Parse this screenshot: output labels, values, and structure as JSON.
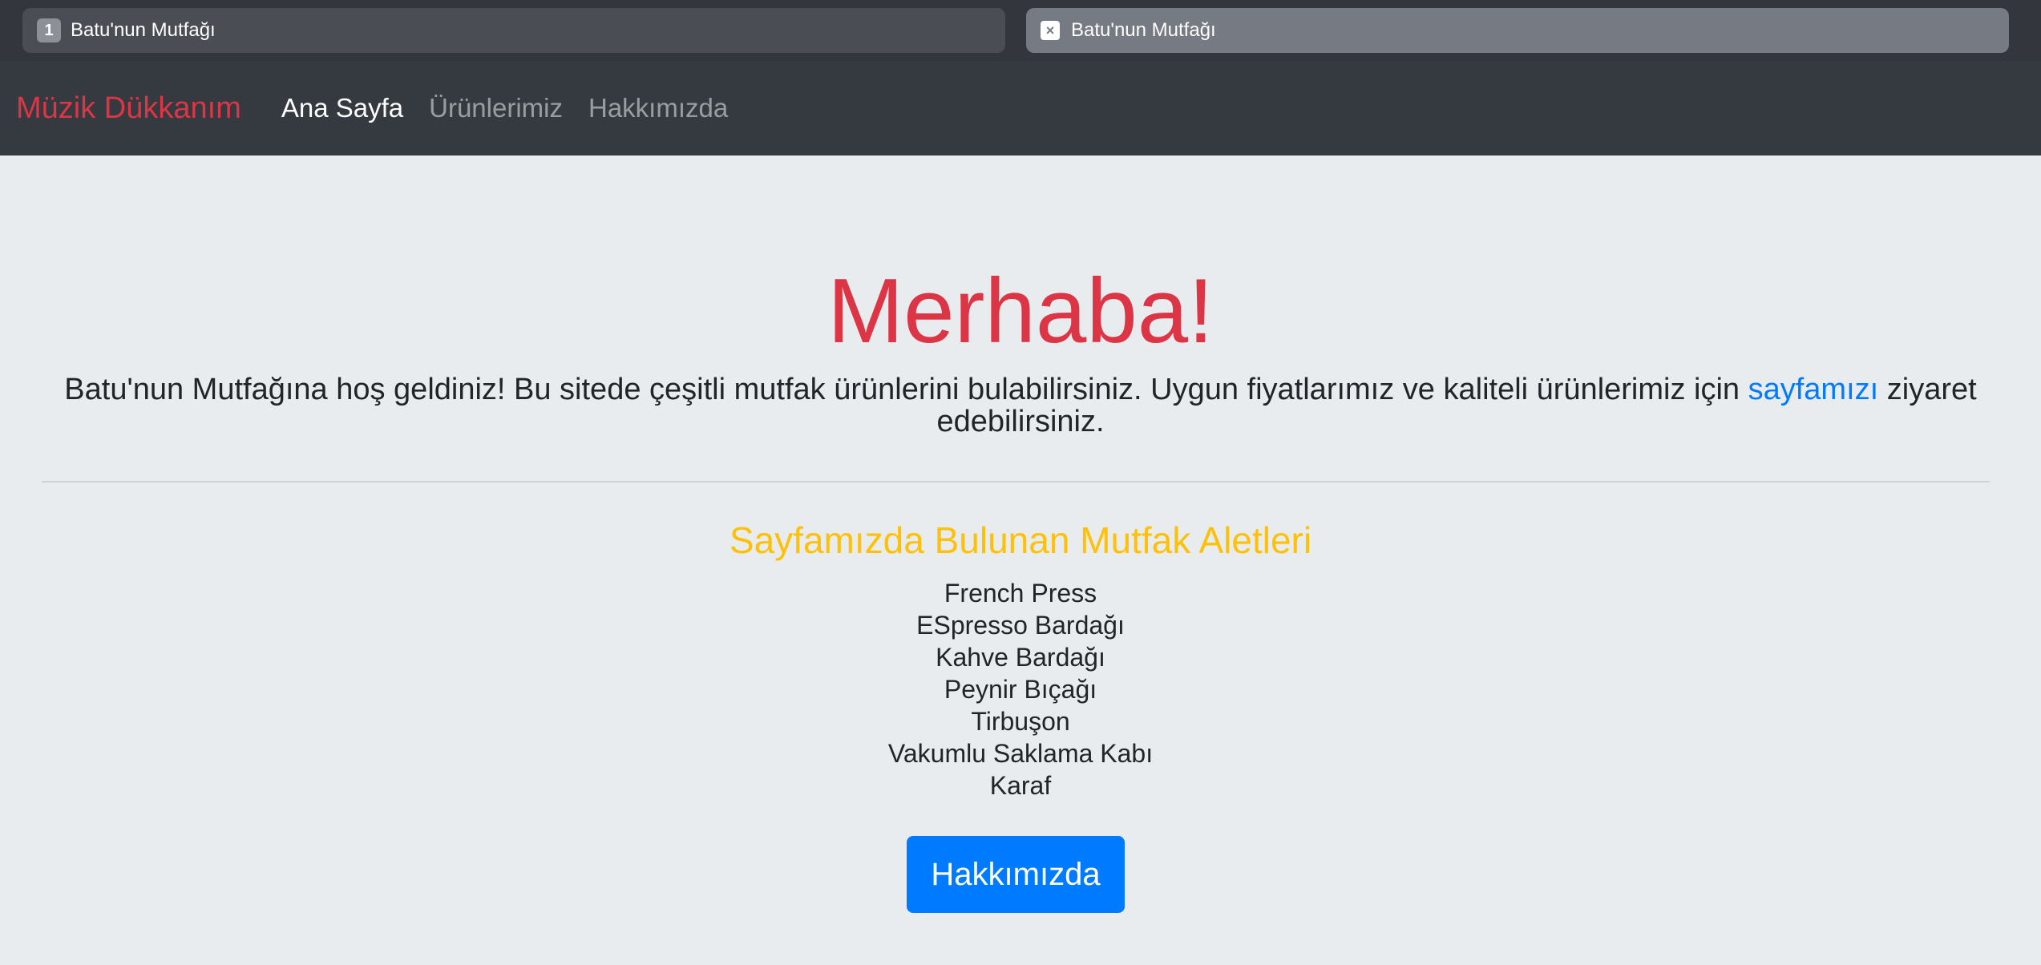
{
  "browser": {
    "tabs": [
      {
        "badge": "1",
        "title": "Batu'nun Mutfağı"
      },
      {
        "badge": "×",
        "title": "Batu'nun Mutfağı"
      }
    ]
  },
  "navbar": {
    "brand": "Müzik Dükkanım",
    "links": [
      {
        "label": "Ana Sayfa"
      },
      {
        "label": "Ürünlerimiz"
      },
      {
        "label": "Hakkımızda"
      }
    ]
  },
  "hero": {
    "heading": "Merhaba!",
    "lead_before": "Batu'nun Mutfağına hoş geldiniz! Bu sitede çeşitli mutfak ürünlerini bulabilirsiniz. Uygun fiyatlarımız ve kaliteli ürünlerimiz için ",
    "lead_link": "sayfamızı",
    "lead_after": " ziyaret edebilirsiniz."
  },
  "tools": {
    "title": "Sayfamızda Bulunan Mutfak Aletleri",
    "items": [
      "French Press",
      "ESpresso Bardağı",
      "Kahve Bardağı",
      "Peynir Bıçağı",
      "Tirbuşon",
      "Vakumlu Saklama Kabı",
      "Karaf"
    ]
  },
  "cta": {
    "label": "Hakkımızda"
  },
  "colors": {
    "navbar_bg": "#343a40",
    "page_bg": "#e9ecef",
    "brand": "#dc3545",
    "heading": "#dc3545",
    "subtitle": "#ffc107",
    "link": "#007bff",
    "button": "#007bff"
  }
}
